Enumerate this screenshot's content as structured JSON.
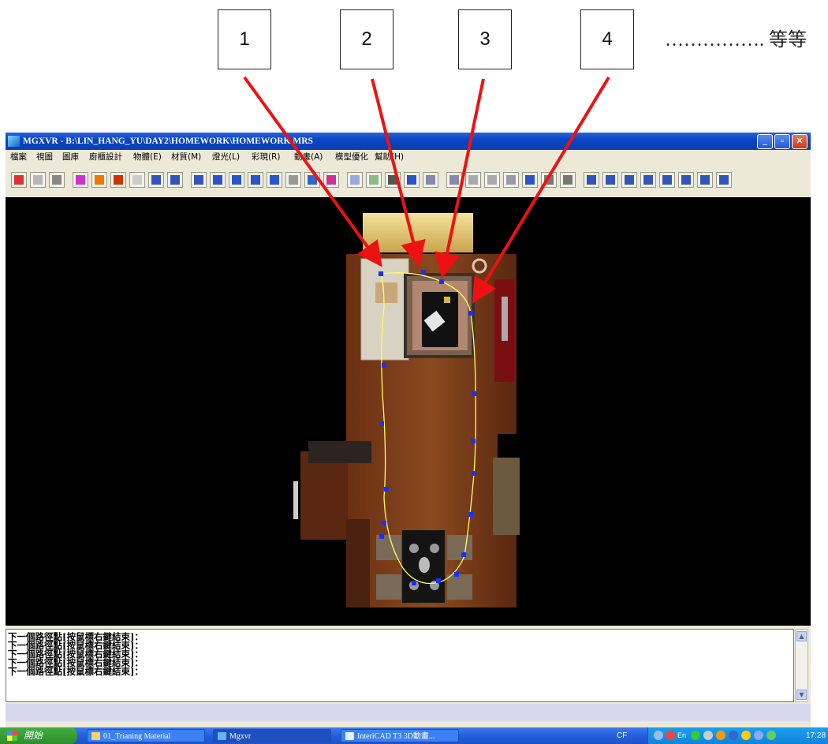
{
  "callouts": [
    "1",
    "2",
    "3",
    "4"
  ],
  "etc_text": "……………. 等等",
  "window": {
    "title": "MGXVR - B:\\LIN_HANG_YU\\DAY2\\HOMEWORK\\HOMEWORK.MRS",
    "min_glyph": "_",
    "max_glyph": "▫",
    "close_glyph": "✕"
  },
  "menu": [
    "檔案",
    "視圖",
    "圖庫",
    "廚櫃設計",
    "物體(E)",
    "材質(M)",
    "燈光(L)",
    "彩現(R)",
    "動畫(A)",
    "模型優化",
    "幫助(H)"
  ],
  "toolbar_icons": [
    "arrow-down-icon",
    "fold-icon",
    "square-icon",
    "color-icon",
    "play-icon",
    "render-icon",
    "sphere-icon",
    "box-front-icon",
    "box-side-icon",
    "box-top-icon",
    "path-start-icon",
    "path-icon",
    "path-end-icon",
    "loop-icon",
    "camera-icon",
    "target-icon",
    "nodes-icon",
    "light-icon",
    "wall-icon",
    "frame-icon",
    "pointer-icon",
    "cube-icon",
    "book-icon",
    "triangle-icon",
    "mountain-icon",
    "tree-icon",
    "bend-icon",
    "join-icon",
    "merge-icon",
    "view1-icon",
    "view2-icon",
    "view3-icon",
    "view4-icon",
    "view5-icon",
    "zoom-icon",
    "view6-icon",
    "fit-icon"
  ],
  "command_lines": [
    "下一個路徑點[按鼠標右鍵結束]：",
    "下一個路徑點[按鼠標右鍵結束]：",
    "下一個路徑點[按鼠標右鍵結束]：",
    "下一個路徑點[按鼠標右鍵結束]：",
    "下一個路徑點[按鼠標右鍵結束]："
  ],
  "taskbar": {
    "start": "開始",
    "items": [
      "01_Trianing Material",
      "Mgxvr",
      "InteriCAD T3 3D動畫..."
    ],
    "lang": "CF",
    "tray_en": "En",
    "clock": "17:28"
  },
  "colors": {
    "path": "#ffff60",
    "node": "#1a2fff",
    "arrow": "#ee1111",
    "titlebar": "#0a45c4"
  }
}
